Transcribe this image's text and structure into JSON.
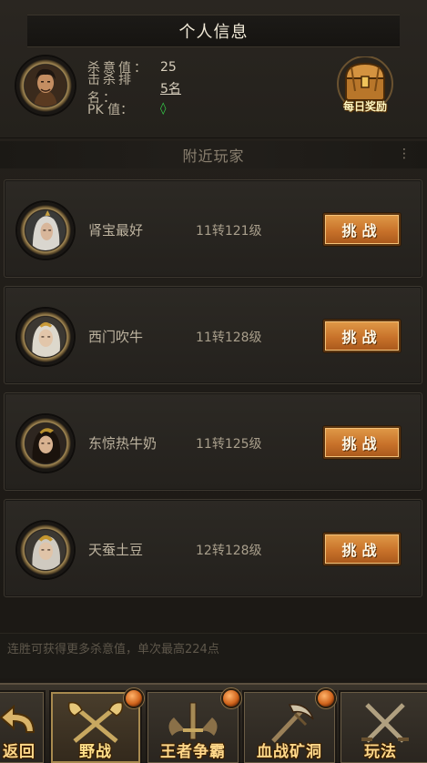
{
  "header": {
    "title": "个人信息",
    "stats": [
      {
        "label": "杀意值：",
        "value": "25"
      },
      {
        "label": "击杀排名：",
        "value": "5名"
      },
      {
        "label": "PK 值：",
        "value": "◊"
      }
    ],
    "daily_reward_label": "每日奖励"
  },
  "nearby": {
    "title": "附近玩家",
    "more_glyph": "⋮"
  },
  "players": [
    {
      "name": "肾宝最好",
      "level": "11转121级",
      "challenge_label": "挑战"
    },
    {
      "name": "西门吹牛",
      "level": "11转128级",
      "challenge_label": "挑战"
    },
    {
      "name": "东惊热牛奶",
      "level": "11转125级",
      "challenge_label": "挑战"
    },
    {
      "name": "天蚕土豆",
      "level": "12转128级",
      "challenge_label": "挑战"
    }
  ],
  "tip": "连胜可获得更多杀意值，单次最高224点",
  "bottom_nav": [
    {
      "label": "返回",
      "icon": "back-arrow-icon"
    },
    {
      "label": "野战",
      "icon": "crossed-axes-icon",
      "active": true
    },
    {
      "label": "王者争霸",
      "icon": "sword-emblem-icon"
    },
    {
      "label": "血战矿洞",
      "icon": "pickaxe-icon"
    },
    {
      "label": "玩法",
      "icon": "crossed-swords-icon"
    }
  ],
  "colors": {
    "accent_button": "#c8722a",
    "pk_indicator": "#36d24a",
    "nav_label": "#ffd88a"
  }
}
